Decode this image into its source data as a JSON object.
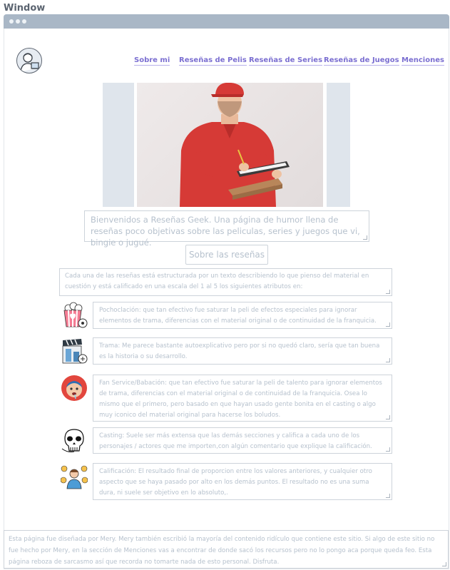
{
  "window": {
    "title": "Window"
  },
  "nav": {
    "items": [
      {
        "label": "Sobre mi"
      },
      {
        "label": "Reseñas de Pelis"
      },
      {
        "label": "Reseñas de Series"
      },
      {
        "label": "Reseñas de Juegos"
      },
      {
        "label": "Menciones"
      }
    ]
  },
  "hero": {
    "image": "delivery-man-clipboard-photo"
  },
  "welcome": {
    "text": "Bienvenidos a Reseñas Geek. Una página de humor llena de reseñas poco objetivas sobre las peliculas, series y juegos que vi, bingie o jugué."
  },
  "about_button": {
    "label": "Sobre las reseñas"
  },
  "intro": {
    "text": "Cada una de las reseñas está estructurada por un texto describiendo lo que pienso del material en cuestión y está calificado en una escala del 1 al 5 los siguientes atributos en:"
  },
  "criteria": [
    {
      "icon": "popcorn-icon",
      "text": "Pochoclación: que tan efectivo fue saturar la peli de efectos especiales para ignorar elementos de trama, diferencias con el material original o de continuidad de la franquicia."
    },
    {
      "icon": "clapperboard-icon",
      "text": "Trama: Me parece bastante autoexplicativo pero por si no quedó claro, sería que tan buena es la historia o su desarrollo."
    },
    {
      "icon": "drooling-face-icon",
      "text": "Fan Service/Babación: que tan efectivo fue saturar la peli de talento para ignorar elementos de trama, diferencias con el material original o de continuidad de la franquicia. Osea lo mismo que el primero, pero basado en que hayan usado gente bonita en el casting o algo muy iconico del material original para hacerse los boludos."
    },
    {
      "icon": "skull-mask-icon",
      "text": "Casting: Suele ser más extensa que las demás secciones y califica a cada uno de los personajes / actores que me importen,con algún comentario que explique la calificación."
    },
    {
      "icon": "rating-person-icon",
      "text": "Calificación: El resultado final de proporcion entre los valores anteriores, y cualquier otro aspecto que se haya pasado por alto en los demás puntos. El resultado no es una suma dura, ni suele ser objetivo en lo absoluto,."
    }
  ],
  "footer": {
    "text": "Esta página fue diseñada por Mery. Mery también escribió la mayoría del contenido ridículo que contiene este sitio. Si algo de este sitio no fue hecho por Mery, en la sección de Menciones vas a encontrar de donde sacó los recursos pero no lo pongo aca porque queda feo. Esta página reboza de sarcasmo así que recorda no tomarte nada de esto personal. Disfruta."
  },
  "colors": {
    "nav_link": "#7b6fd1",
    "titlebar": "#a9b7c6",
    "box_border": "#cdd3da",
    "box_text": "#b6c1cd"
  }
}
